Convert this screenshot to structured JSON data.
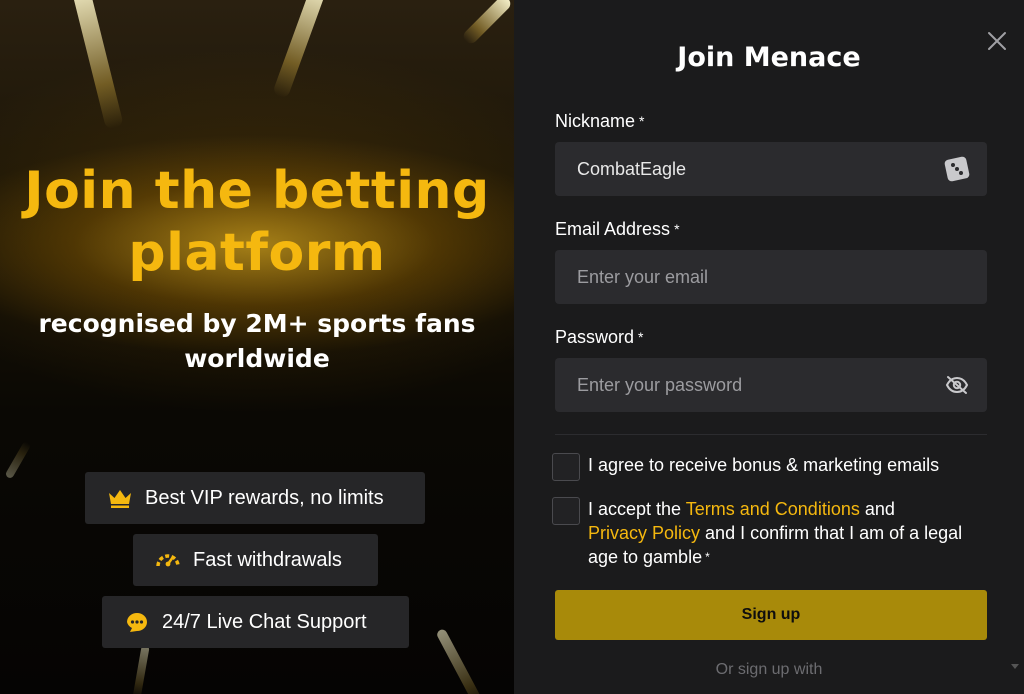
{
  "promo": {
    "title": "Join the betting platform",
    "subtitle": "recognised by 2M+ sports fans worldwide",
    "features": [
      {
        "label": "Best VIP rewards, no limits",
        "icon": "crown-icon"
      },
      {
        "label": "Fast withdrawals",
        "icon": "speedometer-icon"
      },
      {
        "label": "24/7 Live Chat Support",
        "icon": "chat-support-icon"
      }
    ]
  },
  "form": {
    "title": "Join Menace",
    "close_icon": "close-icon",
    "nickname": {
      "label": "Nickname",
      "required": "*",
      "value": "CombatEagle",
      "icon": "dice-icon"
    },
    "email": {
      "label": "Email Address",
      "required": "*",
      "placeholder": "Enter your email"
    },
    "password": {
      "label": "Password",
      "required": "*",
      "placeholder": "Enter your password",
      "icon": "eye-off-icon"
    },
    "marketing_consent": "I agree to receive bonus & marketing emails",
    "terms": {
      "prefix": "I accept the",
      "terms_link": "Terms and Conditions",
      "and": "and",
      "privacy_link": "Privacy Policy",
      "suffix": "and I confirm that I am of a legal age to gamble",
      "required": "*"
    },
    "signup_label": "Sign up",
    "or_signup_with": "Or sign up with"
  },
  "colors": {
    "accent": "#f5b80f",
    "button": "#a88a0a",
    "panel_bg": "#1b1b1c",
    "input_bg": "#2b2b2e"
  }
}
